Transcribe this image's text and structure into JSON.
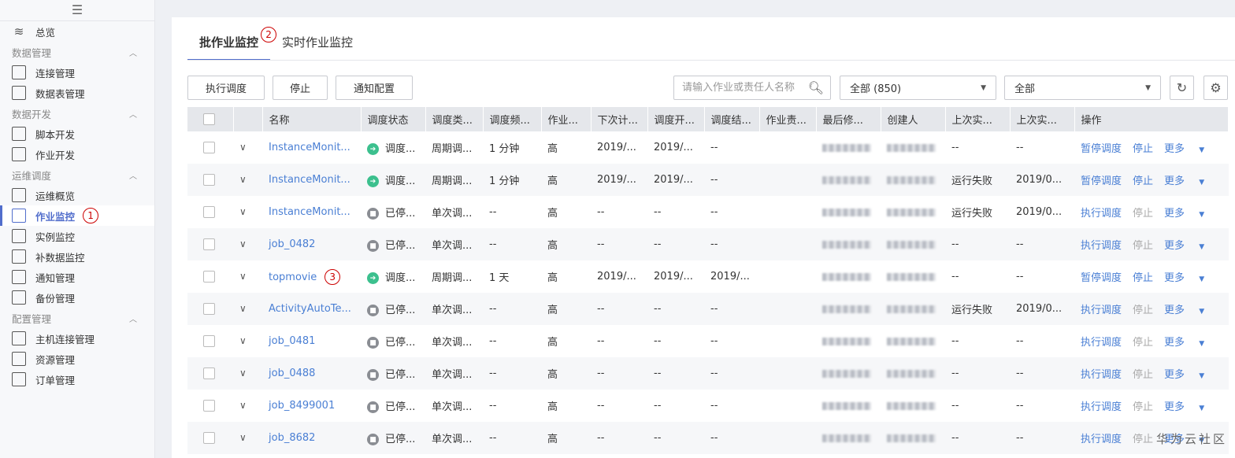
{
  "sidebar": {
    "menu_icon": "hamburger-icon",
    "overview": "总览",
    "groups": [
      {
        "title": "数据管理",
        "items": [
          "连接管理",
          "数据表管理"
        ]
      },
      {
        "title": "数据开发",
        "items": [
          "脚本开发",
          "作业开发"
        ]
      },
      {
        "title": "运维调度",
        "items": [
          "运维概览",
          "作业监控",
          "实例监控",
          "补数据监控",
          "通知管理",
          "备份管理"
        ]
      },
      {
        "title": "配置管理",
        "items": [
          "主机连接管理",
          "资源管理",
          "订单管理"
        ]
      }
    ],
    "active": "作业监控"
  },
  "annotations": [
    "1",
    "2",
    "3"
  ],
  "tabs": [
    "批作业监控",
    "实时作业监控"
  ],
  "toolbar": {
    "run": "执行调度",
    "stop": "停止",
    "notify": "通知配置",
    "search_placeholder": "请输入作业或责任人名称",
    "filter1": "全部 (850)",
    "filter2": "全部"
  },
  "columns": [
    "名称",
    "调度状态",
    "调度类...",
    "调度频...",
    "作业...",
    "下次计...",
    "调度开...",
    "调度结...",
    "作业责...",
    "最后修...",
    "创建人",
    "上次实...",
    "上次实...",
    "操作"
  ],
  "rows": [
    {
      "name": "InstanceMonit...",
      "status": "running",
      "status_text": "调度...",
      "type": "周期调...",
      "freq": "1 分钟",
      "prio": "高",
      "next": "2019/...",
      "start": "2019/...",
      "end": "--",
      "last1": "--",
      "last2": "--",
      "op1": "暂停调度",
      "stop": "停止",
      "more": "更多"
    },
    {
      "name": "InstanceMonit...",
      "status": "running",
      "status_text": "调度...",
      "type": "周期调...",
      "freq": "1 分钟",
      "prio": "高",
      "next": "2019/...",
      "start": "2019/...",
      "end": "--",
      "last1": "运行失败",
      "last2": "2019/0...",
      "op1": "暂停调度",
      "stop": "停止",
      "more": "更多"
    },
    {
      "name": "InstanceMonit...",
      "status": "stopped",
      "status_text": "已停...",
      "type": "单次调...",
      "freq": "--",
      "prio": "高",
      "next": "--",
      "start": "--",
      "end": "--",
      "last1": "运行失败",
      "last2": "2019/0...",
      "op1": "执行调度",
      "stop": "停止",
      "more": "更多"
    },
    {
      "name": "job_0482",
      "status": "stopped",
      "status_text": "已停...",
      "type": "单次调...",
      "freq": "--",
      "prio": "高",
      "next": "--",
      "start": "--",
      "end": "--",
      "last1": "--",
      "last2": "--",
      "op1": "执行调度",
      "stop": "停止",
      "more": "更多"
    },
    {
      "name": "topmovie",
      "status": "running",
      "status_text": "调度...",
      "type": "周期调...",
      "freq": "1 天",
      "prio": "高",
      "next": "2019/...",
      "start": "2019/...",
      "end": "2019/...",
      "last1": "--",
      "last2": "--",
      "op1": "暂停调度",
      "stop": "停止",
      "more": "更多"
    },
    {
      "name": "ActivityAutoTe...",
      "status": "stopped",
      "status_text": "已停...",
      "type": "单次调...",
      "freq": "--",
      "prio": "高",
      "next": "--",
      "start": "--",
      "end": "--",
      "last1": "运行失败",
      "last2": "2019/0...",
      "op1": "执行调度",
      "stop": "停止",
      "more": "更多"
    },
    {
      "name": "job_0481",
      "status": "stopped",
      "status_text": "已停...",
      "type": "单次调...",
      "freq": "--",
      "prio": "高",
      "next": "--",
      "start": "--",
      "end": "--",
      "last1": "--",
      "last2": "--",
      "op1": "执行调度",
      "stop": "停止",
      "more": "更多"
    },
    {
      "name": "job_0488",
      "status": "stopped",
      "status_text": "已停...",
      "type": "单次调...",
      "freq": "--",
      "prio": "高",
      "next": "--",
      "start": "--",
      "end": "--",
      "last1": "--",
      "last2": "--",
      "op1": "执行调度",
      "stop": "停止",
      "more": "更多"
    },
    {
      "name": "job_8499001",
      "status": "stopped",
      "status_text": "已停...",
      "type": "单次调...",
      "freq": "--",
      "prio": "高",
      "next": "--",
      "start": "--",
      "end": "--",
      "last1": "--",
      "last2": "--",
      "op1": "执行调度",
      "stop": "停止",
      "more": "更多"
    },
    {
      "name": "job_8682",
      "status": "stopped",
      "status_text": "已停...",
      "type": "单次调...",
      "freq": "--",
      "prio": "高",
      "next": "--",
      "start": "--",
      "end": "--",
      "last1": "--",
      "last2": "--",
      "op1": "执行调度",
      "stop": "停止",
      "more": "更多"
    }
  ],
  "watermark": "华为云社区",
  "colors": {
    "accent": "#526ecc",
    "link": "#4a7fd4",
    "running": "#3cc08e",
    "stopped": "#8a8d93"
  }
}
